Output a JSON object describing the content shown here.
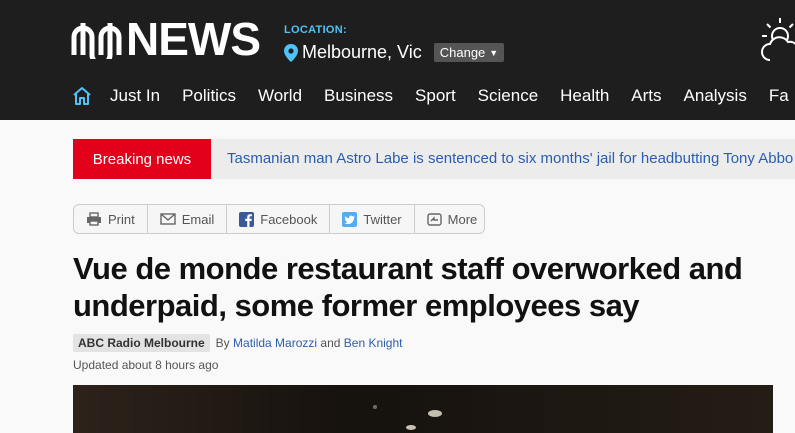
{
  "brand": {
    "logo_text": "NEWS"
  },
  "location": {
    "label": "LOCATION:",
    "city": "Melbourne, Vic",
    "change_label": "Change"
  },
  "nav": {
    "items": [
      "Just In",
      "Politics",
      "World",
      "Business",
      "Sport",
      "Science",
      "Health",
      "Arts",
      "Analysis",
      "Fa"
    ]
  },
  "breaking": {
    "label": "Breaking news",
    "headline": "Tasmanian man Astro Labe is sentenced to six months' jail for headbutting Tony Abbo"
  },
  "share": {
    "print": "Print",
    "email": "Email",
    "facebook": "Facebook",
    "twitter": "Twitter",
    "more": "More"
  },
  "article": {
    "headline": "Vue de monde restaurant staff overworked and underpaid, some former employees say",
    "source": "ABC Radio Melbourne",
    "by": "By",
    "author1": "Matilda Marozzi",
    "and": "and",
    "author2": "Ben Knight",
    "updated": "Updated about 8 hours ago"
  },
  "colors": {
    "header_bg": "#1e1e1e",
    "accent_blue": "#4fc3f7",
    "breaking_red": "#e3001b",
    "link_blue": "#2a5db0"
  },
  "icons": [
    "abc-logo-icon",
    "location-pin-icon",
    "weather-partly-cloudy-icon",
    "home-icon",
    "print-icon",
    "email-icon",
    "facebook-icon",
    "twitter-icon",
    "more-icon"
  ]
}
